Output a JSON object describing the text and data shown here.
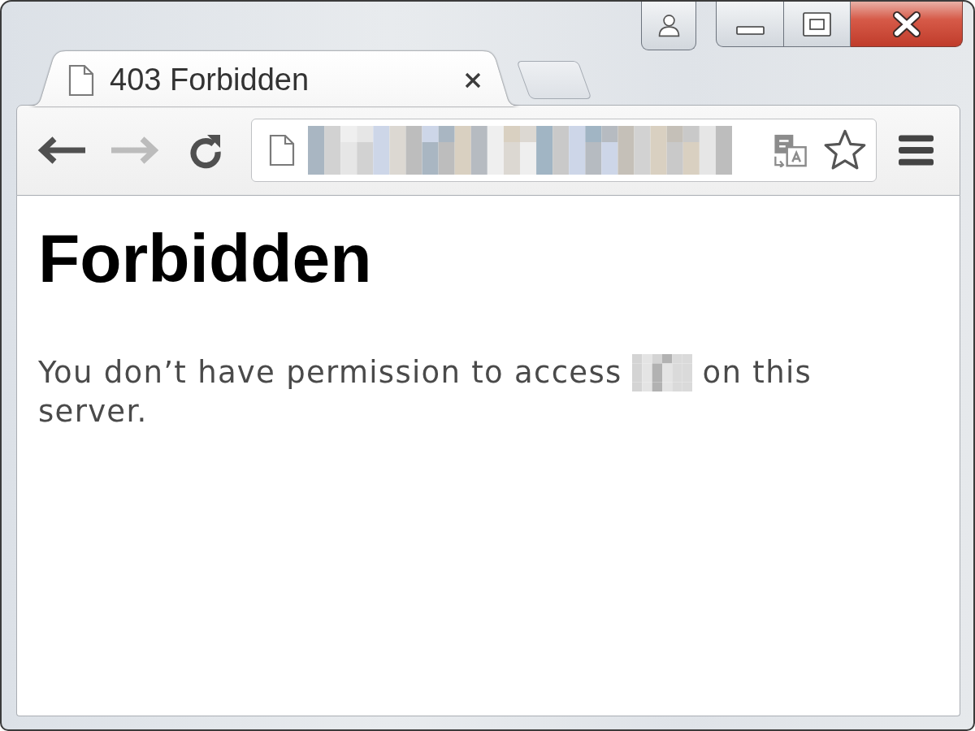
{
  "window": {
    "caption_buttons": [
      {
        "kind": "profile"
      },
      {
        "kind": "minimize"
      },
      {
        "kind": "maximize"
      },
      {
        "kind": "close"
      }
    ]
  },
  "tabs": [
    {
      "title": "403 Forbidden",
      "selected": true
    }
  ],
  "toolbar": {
    "nav_buttons": [
      {
        "kind": "back",
        "disabled": false
      },
      {
        "kind": "forward",
        "disabled": true
      },
      {
        "kind": "reload",
        "disabled": false
      }
    ]
  },
  "address_bar": {
    "url_redacted": true,
    "bookmarked": false
  },
  "page": {
    "heading": "Forbidden",
    "message_lines": [
      {
        "text": "You don’t have permission to access",
        "redacted_path": true,
        "after": "on this"
      },
      {
        "text": "server."
      }
    ]
  }
}
